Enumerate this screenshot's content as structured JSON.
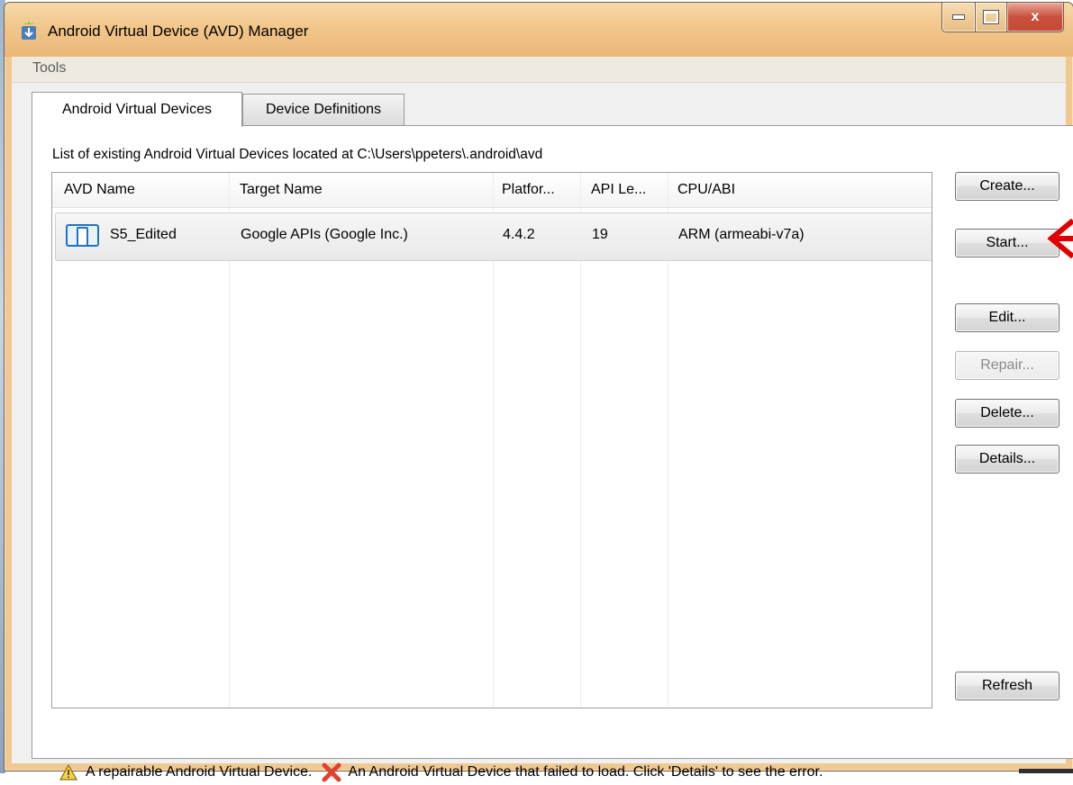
{
  "window": {
    "title": "Android Virtual Device (AVD) Manager"
  },
  "controls": {
    "close_label": "x"
  },
  "menu": {
    "tools": "Tools"
  },
  "tabs": [
    {
      "label": "Android Virtual Devices",
      "active": true
    },
    {
      "label": "Device Definitions",
      "active": false
    }
  ],
  "avd_path_label": "List of existing Android Virtual Devices located at C:\\Users\\ppeters\\.android\\avd",
  "table": {
    "headers": [
      "AVD Name",
      "Target Name",
      "Platfor...",
      "API Le...",
      "CPU/ABI"
    ],
    "rows": [
      {
        "avd_name": "S5_Edited",
        "target": "Google APIs (Google Inc.)",
        "platform": "4.4.2",
        "api": "19",
        "cpu": "ARM (armeabi-v7a)",
        "selected": true
      }
    ]
  },
  "buttons": {
    "create": "Create...",
    "start": "Start...",
    "edit": "Edit...",
    "repair": "Repair...",
    "delete": "Delete...",
    "details": "Details...",
    "refresh": "Refresh"
  },
  "legend": {
    "repairable": "A repairable Android Virtual Device.",
    "failed": "An Android Virtual Device that failed to load. Click 'Details' to see the error."
  },
  "icons": {
    "app": "android-download-icon",
    "device": "device-icon",
    "warning": "warning-triangle-icon",
    "error": "red-x-icon",
    "annotation": "red-arrow-icon"
  },
  "colors": {
    "title_bar": "#f1c68b",
    "close_button": "#c8503d",
    "annotation_arrow": "#e00000"
  }
}
